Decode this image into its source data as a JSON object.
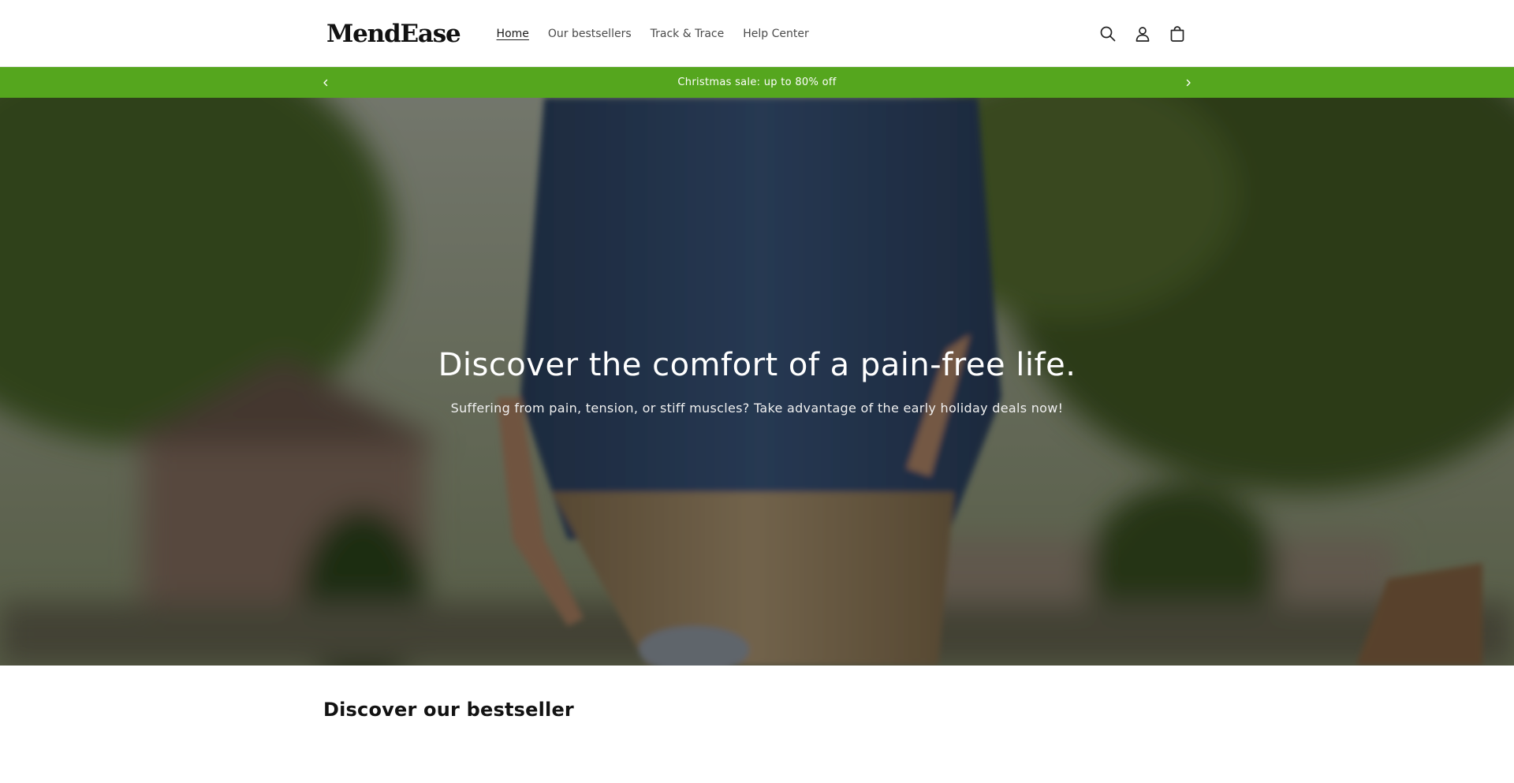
{
  "header": {
    "logo": "MendEase",
    "nav": [
      {
        "label": "Home",
        "active": true
      },
      {
        "label": "Our bestsellers",
        "active": false
      },
      {
        "label": "Track & Trace",
        "active": false
      },
      {
        "label": "Help Center",
        "active": false
      }
    ],
    "icons": [
      "search-icon",
      "account-icon",
      "cart-icon"
    ]
  },
  "announcement": {
    "text": "Christmas sale: up to 80% off",
    "bg_color": "#55a61e"
  },
  "hero": {
    "title": "Discover the comfort of a pain-free life.",
    "subtitle": "Suffering from pain, tension, or stiff muscles? Take advantage of the early holiday deals now!"
  },
  "section": {
    "title": "Discover our bestseller"
  }
}
